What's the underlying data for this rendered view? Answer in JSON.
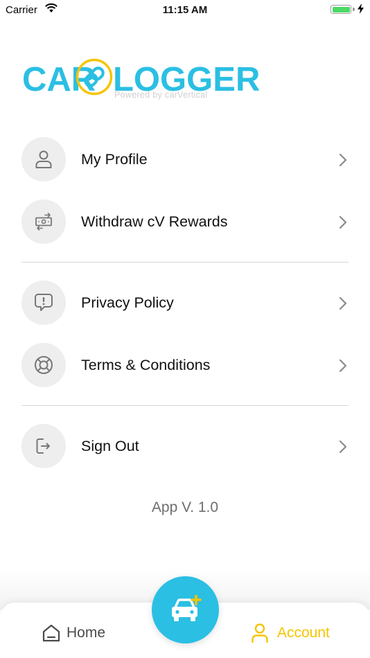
{
  "status_bar": {
    "carrier": "Carrier",
    "time": "11:15 AM",
    "battery_level": 1.0
  },
  "logo": {
    "left_word": "CAR",
    "right_word": "LOGGER",
    "tagline": "Powered by carVertical",
    "colors": {
      "text": "#2bbfe3",
      "ring": "#f5c400"
    }
  },
  "menu": {
    "items": [
      {
        "label": "My Profile",
        "icon": "user-icon"
      },
      {
        "label": "Withdraw cV Rewards",
        "icon": "money-transfer-icon"
      },
      {
        "label": "Privacy Policy",
        "icon": "alert-message-icon"
      },
      {
        "label": "Terms & Conditions",
        "icon": "lifebuoy-icon"
      },
      {
        "label": "Sign Out",
        "icon": "sign-out-icon"
      }
    ]
  },
  "version": "App V. 1.0",
  "tab_bar": {
    "home": {
      "label": "Home",
      "icon": "home-icon"
    },
    "center": {
      "icon": "add-car-icon"
    },
    "account": {
      "label": "Account",
      "icon": "account-icon",
      "active": true
    },
    "colors": {
      "accent": "#f5c400",
      "fab": "#2bbfe3"
    }
  }
}
